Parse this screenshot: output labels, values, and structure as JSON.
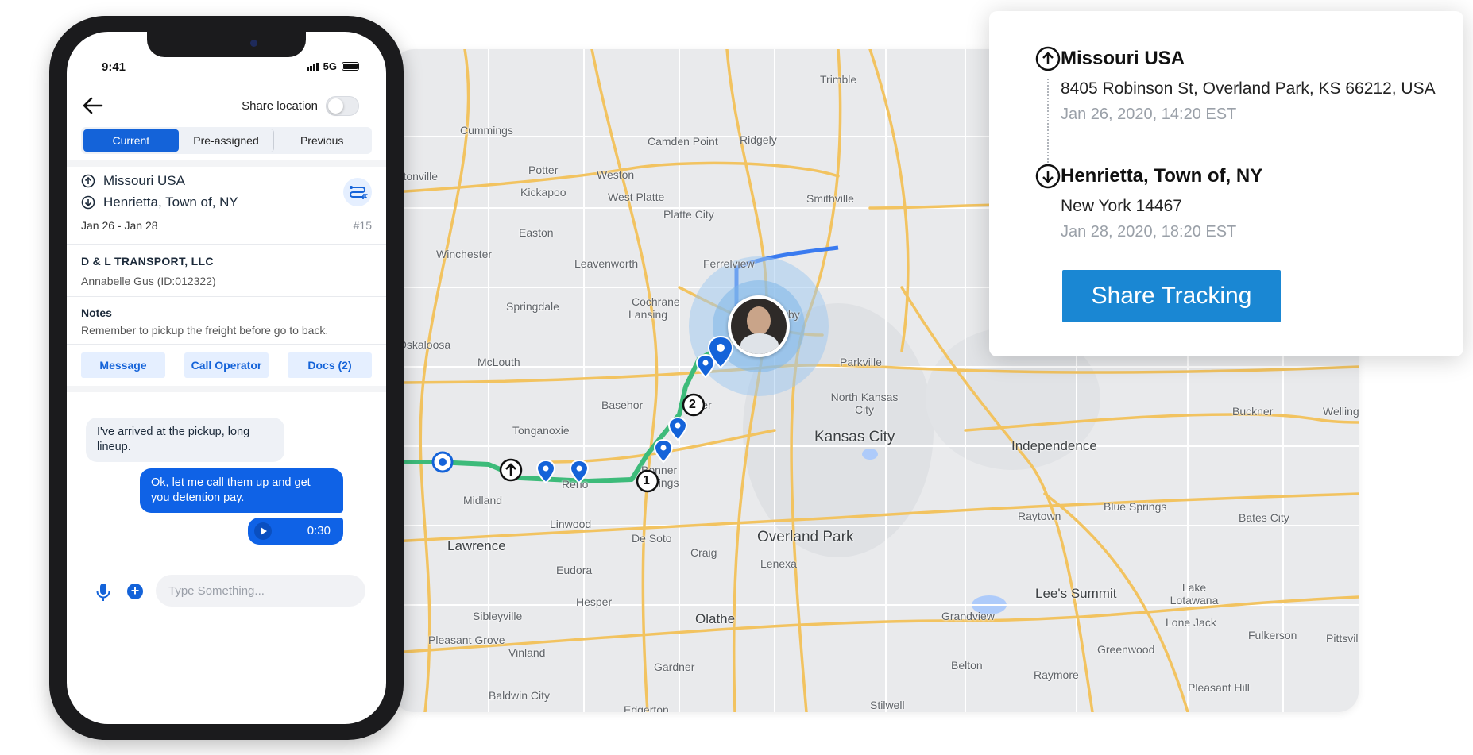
{
  "phone": {
    "status": {
      "time": "9:41",
      "network": "5G"
    },
    "header": {
      "share_location_label": "Share location",
      "share_location_on": false
    },
    "tabs": [
      {
        "label": "Current",
        "active": true
      },
      {
        "label": "Pre-assigned",
        "active": false
      },
      {
        "label": "Previous",
        "active": false
      }
    ],
    "load": {
      "pickup": "Missouri USA",
      "dropoff": "Henrietta, Town of, NY",
      "dates": "Jan 26 - Jan 28",
      "number": "#15"
    },
    "carrier": {
      "company": "D & L TRANSPORT, LLC",
      "driver": "Annabelle Gus (ID:012322)"
    },
    "notes": {
      "heading": "Notes",
      "text": "Remember to pickup the freight before go to back."
    },
    "actions": {
      "message": "Message",
      "call_operator": "Call Operator",
      "docs": "Docs (2)"
    },
    "chat": {
      "incoming": "I've arrived at the pickup, long lineup.",
      "outgoing": "Ok, let me call them up and get you detention pay.",
      "audio_duration": "0:30"
    },
    "composer": {
      "placeholder": "Type Something..."
    }
  },
  "map": {
    "places": [
      "Trimble",
      "Cummings",
      "Camden Point",
      "Ridgely",
      "Potter",
      "ortonville",
      "Weston",
      "Kickapoo",
      "West Platte",
      "Smithville",
      "Platte City",
      "Easton",
      "Winchester",
      "Ferrelview",
      "Leavenworth",
      "Cochrane",
      "Springdale",
      "Lansing",
      "Weatherby Lake",
      "Oskaloosa",
      "McLouth",
      "Parkville",
      "North Kansas City",
      "Basehor",
      "Piper",
      "Tonganoxie",
      "Kansas City",
      "Independence",
      "Buckner",
      "Welling",
      "Bonner Springs",
      "Reno",
      "Blue Springs",
      "Midland",
      "Raytown",
      "Bates City",
      "Linwood",
      "De Soto",
      "Craig",
      "Overland Park",
      "Lawrence",
      "Eudora",
      "Lenexa",
      "Lake Lotawana",
      "Hesper",
      "Sibleyville",
      "Olathe",
      "Lee's Summit",
      "Grandview",
      "Pleasant Grove",
      "Lone Jack",
      "Fulkerson",
      "Pittsvil",
      "Vinland",
      "Greenwood",
      "Gardner",
      "Belton",
      "Raymore",
      "Pleasant Hill",
      "Baldwin City",
      "Edgerton",
      "Stilwell",
      "Edgerton"
    ],
    "route_stops": [
      "1",
      "2"
    ],
    "colors": {
      "route": "#3dbb7a",
      "route_blue": "#3a7bf0",
      "highway": "#f2c360",
      "pin": "#1463d9",
      "location_halo": "#5aa6e6"
    }
  },
  "card": {
    "pickup": {
      "title": "Missouri USA",
      "address": "8405 Robinson St, Overland Park, KS 66212, USA",
      "time": "Jan 26, 2020, 14:20 EST"
    },
    "dropoff": {
      "title": "Henrietta, Town of, NY",
      "address": "New York 14467",
      "time": "Jan 28, 2020, 18:20 EST"
    },
    "button": "Share Tracking"
  }
}
